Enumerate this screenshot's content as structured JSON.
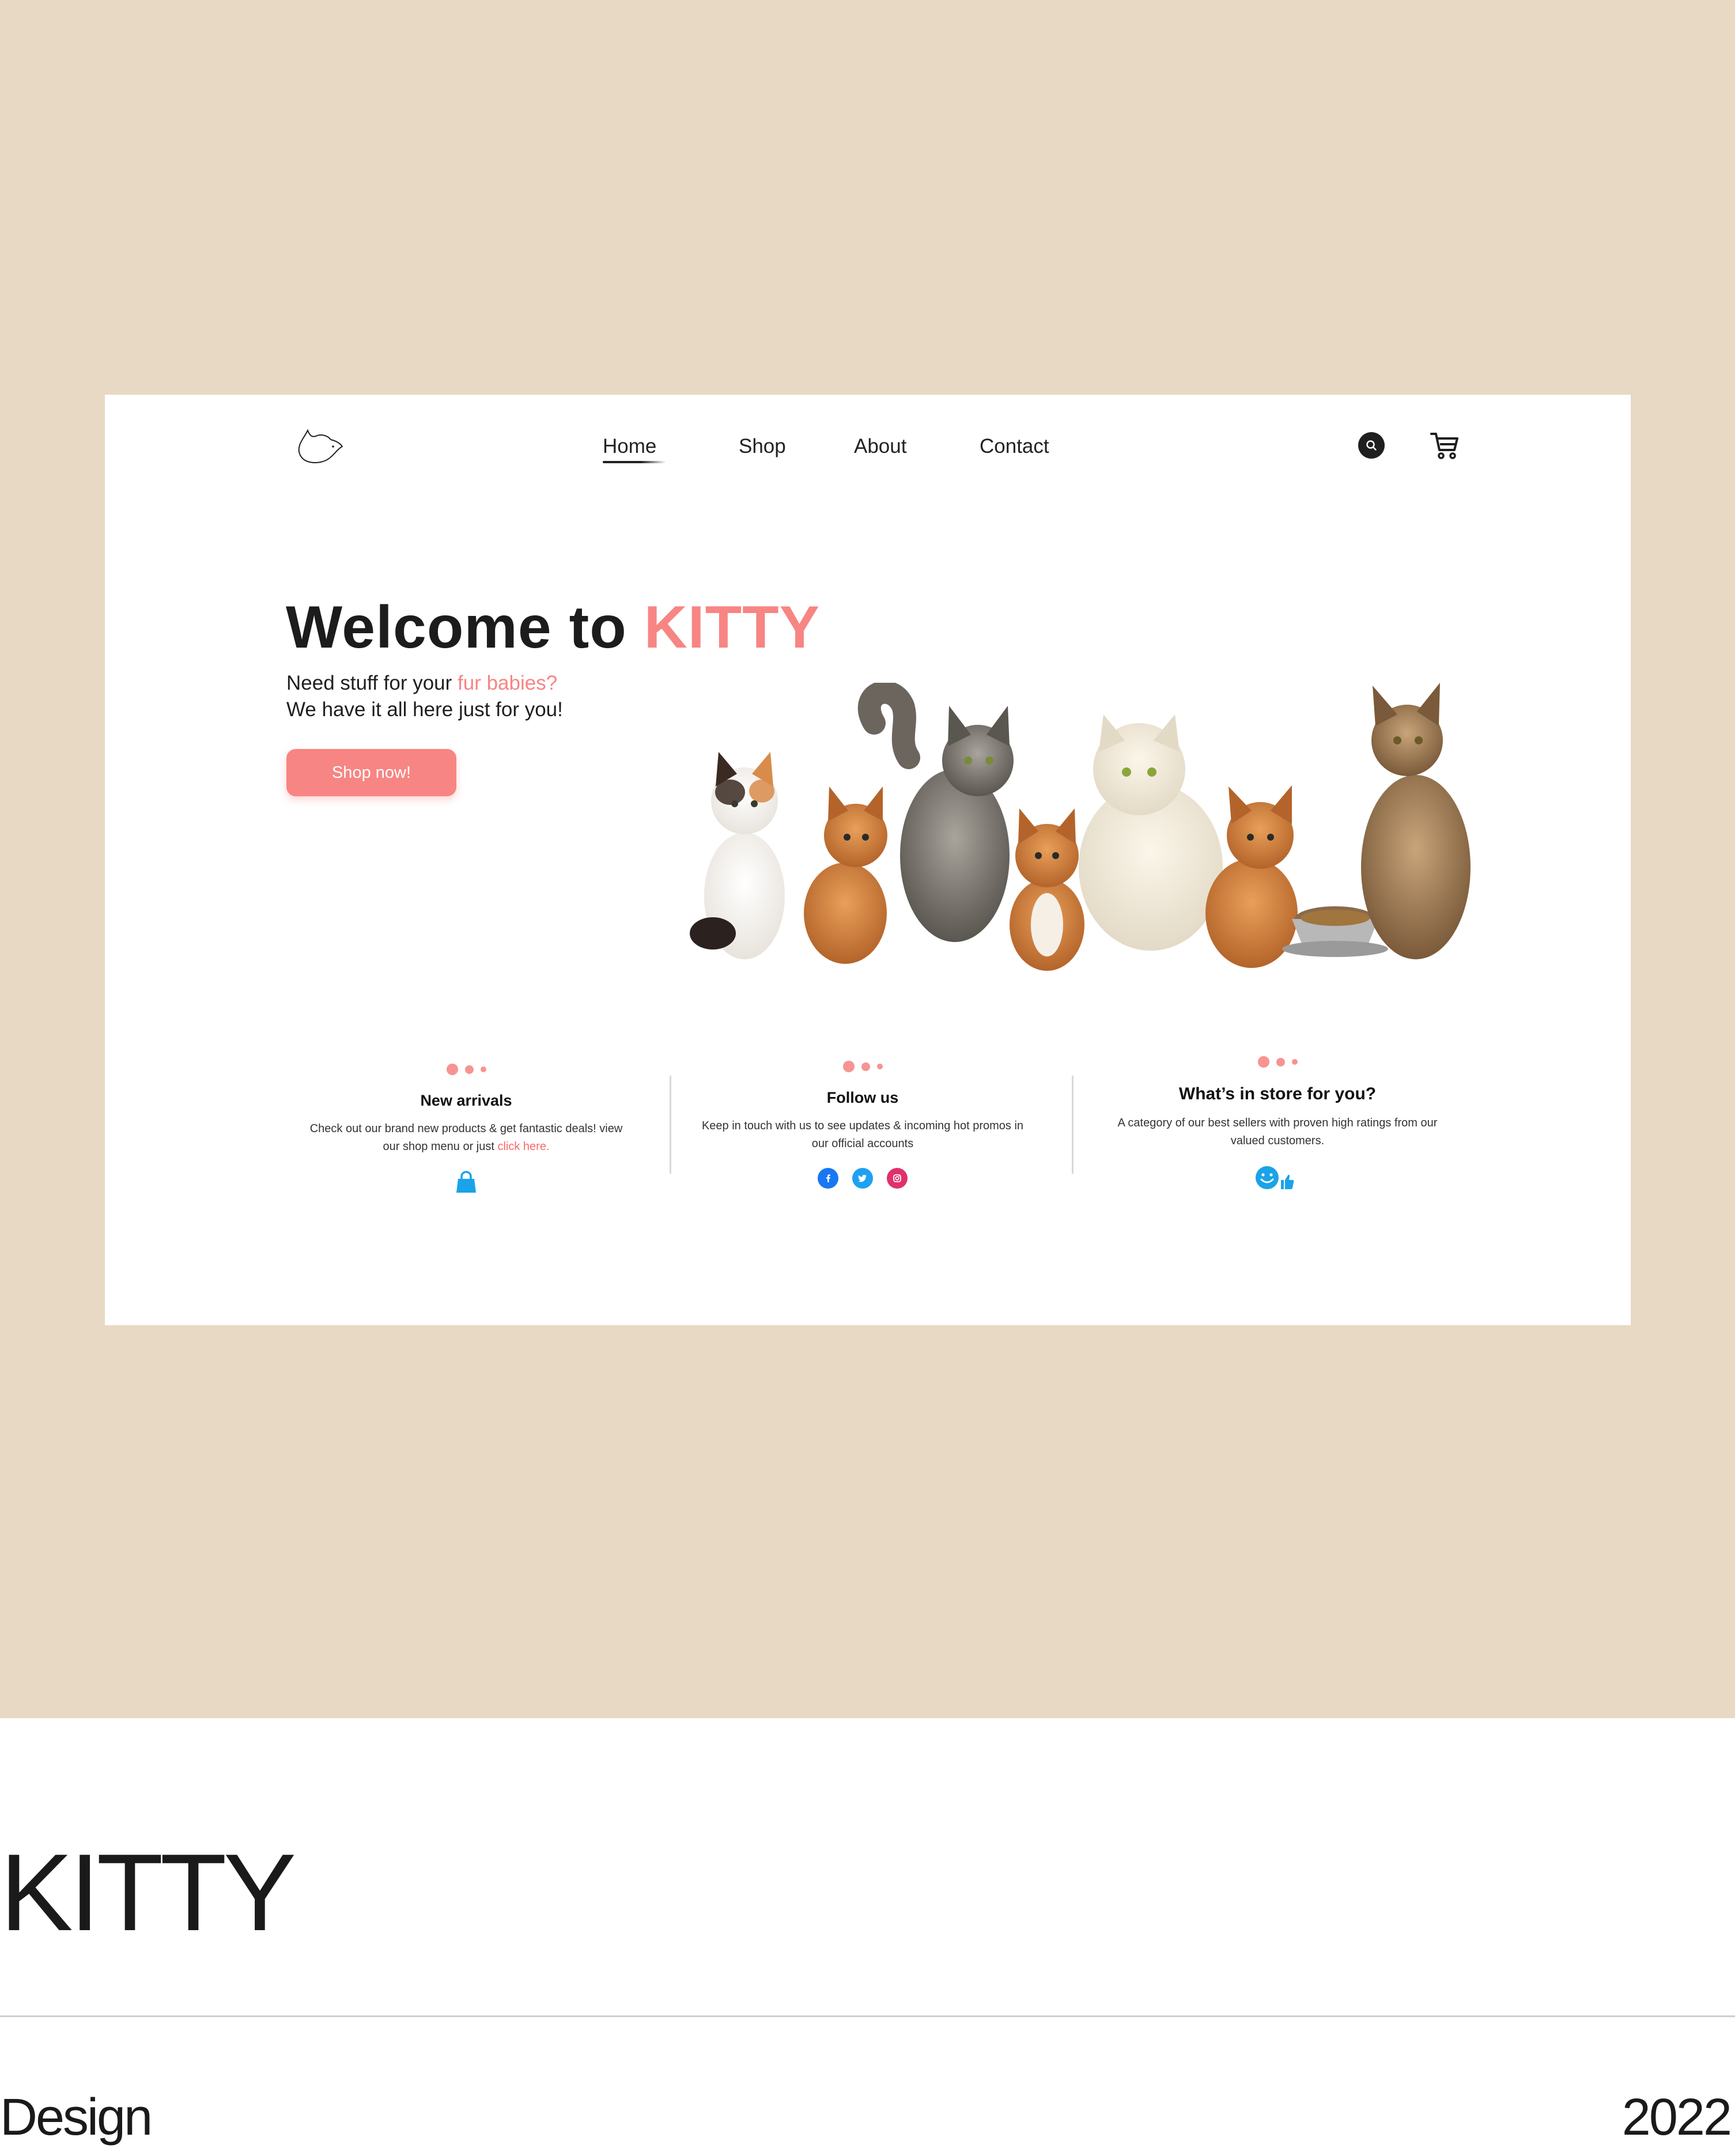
{
  "colors": {
    "page_background": "#e8d9c4",
    "accent": "#f78583",
    "card_dots": "#f79491",
    "text_dark": "#1f1f1f",
    "facebook": "#1877f2",
    "twitter": "#1da1f2",
    "instagram": "#e1306c",
    "bag_icon": "#1aa3e8",
    "smile_icon": "#1aa3e8"
  },
  "nav": {
    "logo_icon": "cat-head-outline-icon",
    "items": [
      {
        "label": "Home",
        "active": true
      },
      {
        "label": "Shop",
        "active": false
      },
      {
        "label": "About",
        "active": false
      },
      {
        "label": "Contact",
        "active": false
      }
    ],
    "search_icon": "search-icon",
    "cart_icon": "cart-icon"
  },
  "hero": {
    "title_prefix": "Welcome to",
    "title_brand": "KITTY",
    "subtitle_prefix": "Need stuff for your",
    "subtitle_accent": "fur babies?",
    "subtitle_line2": "We have it all here just for you!",
    "cta_label": "Shop now!",
    "illustration": "group-of-seven-cats-with-food-bowl"
  },
  "cards": [
    {
      "title": "New arrivals",
      "text": "Check out our brand new products  & get fantastic deals! view our shop menu or just",
      "link_text": "click here.",
      "icon": "shopping-bag-icon"
    },
    {
      "title": "Follow us",
      "text": "Keep in touch with us to see updates & incoming hot promos in our official accounts",
      "icons": [
        "facebook-icon",
        "twitter-icon",
        "instagram-icon"
      ]
    },
    {
      "title": "What’s in store for you?",
      "text": "A category of our best sellers with proven high ratings from our valued customers.",
      "icon": "smile-thumbs-up-icon"
    }
  ],
  "caption": {
    "title": "KITTY",
    "category": "Design",
    "year": "2022"
  }
}
